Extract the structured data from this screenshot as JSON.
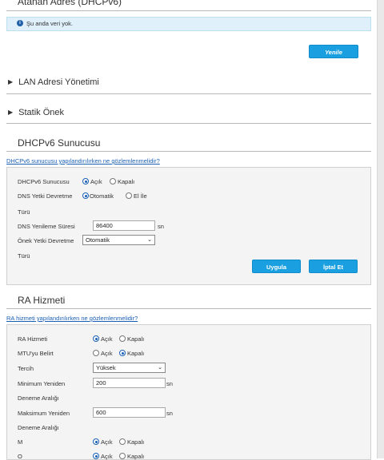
{
  "top_section": {
    "title": "Atanan Adres (DHCPv6)",
    "info_text": "Şu anda veri yok.",
    "refresh_label": "Yenile"
  },
  "collapsibles": [
    {
      "label": "LAN Adresi Yönetimi"
    },
    {
      "label": "Statik Önek"
    }
  ],
  "dhcp": {
    "title": "DHCPv6 Sunucusu",
    "help_link": "DHCPv6 sunucusu yapılandırılırken ne gözlemlenmelidir?",
    "server_label": "DHCPv6 Sunucusu",
    "server_on": "Açık",
    "server_off": "Kapalı",
    "dns_label": "DNS Yetki Devretme",
    "dns_type_label": "Türü",
    "dns_auto": "Otomatik",
    "dns_manual": "El İle",
    "renew_label": "DNS Yenileme Süresi",
    "renew_value": "86400",
    "renew_unit": "sn",
    "prefix_label": "Önek Yetki Devretme",
    "prefix_type_label": "Türü",
    "prefix_value": "Otomatik",
    "apply_label": "Uygula",
    "cancel_label": "İptal Et"
  },
  "ra": {
    "title": "RA Hizmeti",
    "help_link": "RA hizmeti yapılandırılırken ne gözlemlenmelidir?",
    "service_label": "RA Hizmeti",
    "mtu_label": "MTU'yu Belirt",
    "pref_label": "Tercih",
    "pref_value": "Yüksek",
    "min_label": "Minimum Yeniden",
    "min_label2": "Deneme Aralığı",
    "min_value": "200",
    "max_label": "Maksimum Yeniden",
    "max_label2": "Deneme Aralığı",
    "max_value": "600",
    "unit": "sn",
    "m_label": "M",
    "o_label": "O",
    "on": "Açık",
    "off": "Kapalı"
  }
}
